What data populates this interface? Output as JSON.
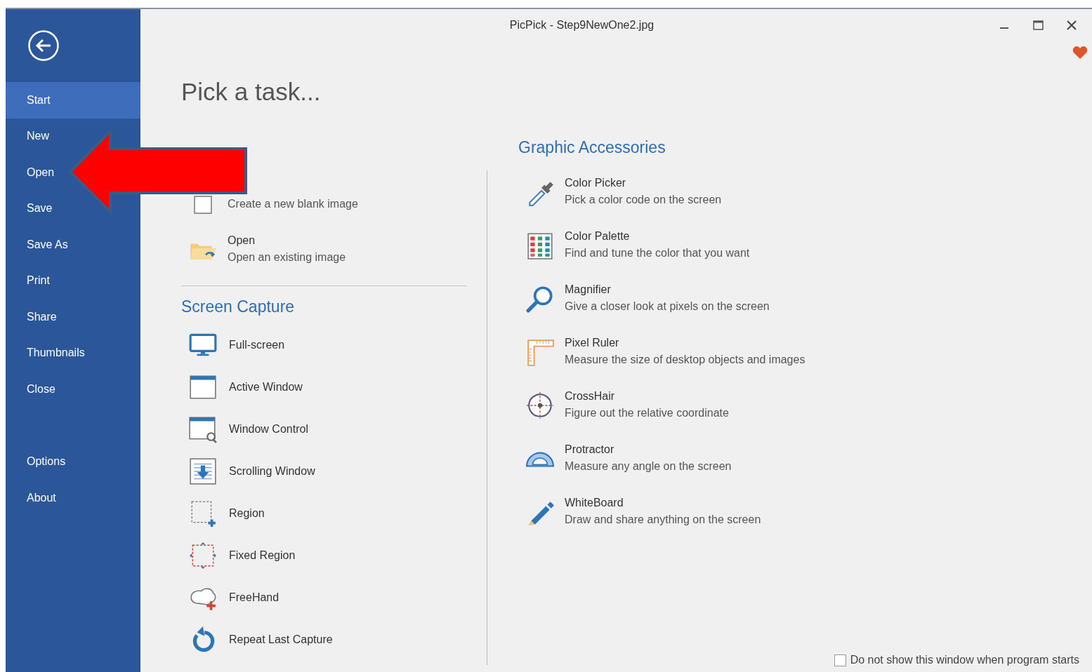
{
  "window": {
    "title": "PicPick - Step9NewOne2.jpg"
  },
  "sidebar": {
    "items": [
      {
        "label": "Start",
        "selected": true
      },
      {
        "label": "New",
        "selected": false
      },
      {
        "label": "Open",
        "selected": false
      },
      {
        "label": "Save",
        "selected": false
      },
      {
        "label": "Save As",
        "selected": false
      },
      {
        "label": "Print",
        "selected": false
      },
      {
        "label": "Share",
        "selected": false
      },
      {
        "label": "Thumbnails",
        "selected": false
      },
      {
        "label": "Close",
        "selected": false
      }
    ],
    "bottom_items": [
      {
        "label": "Options",
        "selected": false
      },
      {
        "label": "About",
        "selected": false
      }
    ]
  },
  "heading": "Pick a task...",
  "new_task": {
    "items": [
      {
        "kind": "blank",
        "description": "Create a new blank image"
      },
      {
        "kind": "open",
        "title": "Open",
        "description": "Open an existing image"
      }
    ]
  },
  "screen_capture": {
    "title": "Screen Capture",
    "items": [
      {
        "kind": "fullscreen",
        "label": "Full-screen"
      },
      {
        "kind": "active",
        "label": "Active Window"
      },
      {
        "kind": "control",
        "label": "Window Control"
      },
      {
        "kind": "scrolling",
        "label": "Scrolling Window"
      },
      {
        "kind": "region",
        "label": "Region"
      },
      {
        "kind": "fixed",
        "label": "Fixed Region"
      },
      {
        "kind": "freehand",
        "label": "FreeHand"
      },
      {
        "kind": "repeat",
        "label": "Repeat Last Capture"
      }
    ]
  },
  "graphic_accessories": {
    "title": "Graphic Accessories",
    "items": [
      {
        "kind": "picker",
        "title": "Color Picker",
        "description": "Pick a color code on the screen"
      },
      {
        "kind": "palette",
        "title": "Color Palette",
        "description": "Find and tune the color that you want"
      },
      {
        "kind": "magnifier",
        "title": "Magnifier",
        "description": "Give a closer look at pixels on the screen"
      },
      {
        "kind": "ruler",
        "title": "Pixel Ruler",
        "description": "Measure the size of desktop objects and images"
      },
      {
        "kind": "crosshair",
        "title": "CrossHair",
        "description": "Figure out the relative coordinate"
      },
      {
        "kind": "protractor",
        "title": "Protractor",
        "description": "Measure any angle on the screen"
      },
      {
        "kind": "whiteboard",
        "title": "WhiteBoard",
        "description": "Draw and share anything on the screen"
      }
    ]
  },
  "startup_checkbox": {
    "label": "Do not show this window when program starts",
    "checked": false
  }
}
